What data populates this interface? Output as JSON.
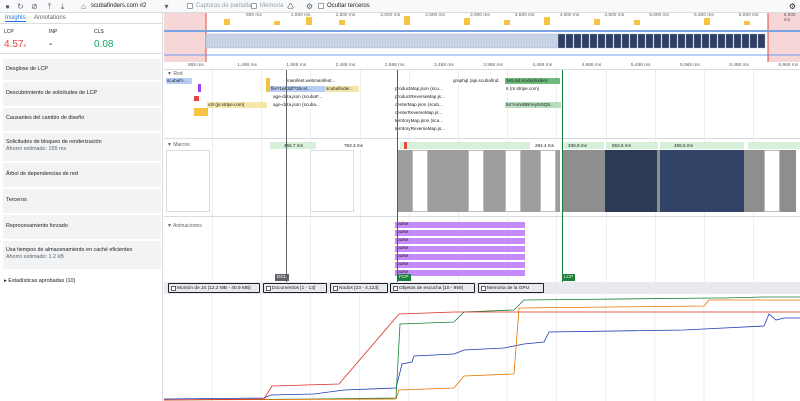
{
  "toolbar": {
    "url": "scubafinders.com #2",
    "screenshots_label": "Capturas de pantalla",
    "memory_label": "Memoria",
    "hide_third_label": "Ocultar terceros"
  },
  "tabs": {
    "insights": "Insights",
    "annotations": "Annotations"
  },
  "metrics": {
    "lcp_label": "LCP",
    "lcp_value": "4.57",
    "lcp_unit": "s",
    "inp_label": "INP",
    "inp_value": "-",
    "cls_label": "CLS",
    "cls_value": "0.08",
    "bad_color": "#e8453c",
    "good_color": "#0ca664"
  },
  "insights": [
    {
      "title": "Desglose de LCP",
      "sub": ""
    },
    {
      "title": "Descubrimiento de solicitudes de LCP",
      "sub": ""
    },
    {
      "title": "Causantes del cambio de diseño",
      "sub": ""
    },
    {
      "title": "Solicitudes de bloqueo de renderización",
      "sub": "Ahorro estimado: 155 ms"
    },
    {
      "title": "Árbol de dependencias de red",
      "sub": ""
    },
    {
      "title": "Terceros",
      "sub": ""
    },
    {
      "title": "Reprocesamiento forzado",
      "sub": ""
    },
    {
      "title": "Usa tiempos de almacenamiento en caché eficientes",
      "sub": "Ahorro estimado: 1.2 kB"
    }
  ],
  "passed_label": "Estadísticas aprobadas (10)",
  "overview_ticks": [
    "500 ms",
    "1,000 ms",
    "1,500 ms",
    "2,000 ms",
    "2,500 ms",
    "3,000 ms",
    "3,500 ms",
    "4,000 ms",
    "4,500 ms",
    "5,000 ms",
    "5,500 ms",
    "6,000 ms",
    "6,500 ms"
  ],
  "ruler_ticks": [
    "888 ms",
    "1,488 ms",
    "1,988 ms",
    "2,488 ms",
    "2,988 ms",
    "3,488 ms",
    "3,988 ms",
    "4,488 ms",
    "4,988 ms",
    "5,488 ms",
    "5,988 ms",
    "6,488 ms",
    "6,988 ms"
  ],
  "tracks": {
    "network": "▼ Red",
    "frames": "▼ Marcos",
    "animations": "▼ Animaciones"
  },
  "requests": [
    "scubaFi...",
    "manifest.webmanifest...",
    "file?1e63df?3bcel...",
    "scubafinder...",
    "age-data.json (scubaF...",
    "age-data.json (scuba...",
    "v3/ (js.stripe.com)",
    "graphql (api.scubafind...",
    "1e5.6d.scubafinders",
    "6 (m.stripe.com)",
    "54?AmnBBrrey5r5Q8...",
    "productMap.json (scu...",
    "productReverseMap.js...",
    "centerMap.json (scub...",
    "centerReverseMap.js...",
    "territoryMap.json (sca...",
    "territoryReverseMap.js..."
  ],
  "frame_times": [
    "466.7 ms",
    "783.3 ms",
    "284.4 ms",
    "338.9 ms",
    "553.6 ms",
    "455.5 ms"
  ],
  "anim_label": "pulse",
  "markers": {
    "dcl": "DCL",
    "fcp": "FCP",
    "lcp": "LCP"
  },
  "counters": [
    {
      "label": "Montón de JS [12.2 MB - 40.9 MB]",
      "color": "#1a3bb3",
      "bg": "#d2dbf7"
    },
    {
      "label": "Documentos [1 - 13]",
      "color": "#d93025",
      "bg": "#fad2cf"
    },
    {
      "label": "Nodos [23 - 4,123]",
      "color": "#188038",
      "bg": "#ceead6"
    },
    {
      "label": "Objetos de escucha [10 - 959]",
      "color": "#e37400",
      "bg": "#fde7c4"
    },
    {
      "label": "Memoria de la GPU",
      "color": "#a142f4",
      "bg": "#ecd7fc"
    }
  ]
}
